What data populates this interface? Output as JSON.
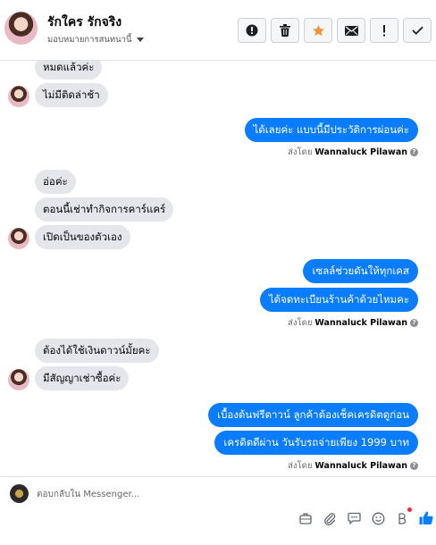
{
  "header": {
    "contact_name": "รักใคร รักจริง",
    "assignment_label": "มอบหมายการสนทนานี้",
    "actions": [
      {
        "name": "spam-button",
        "icon": "alert-circle-icon"
      },
      {
        "name": "delete-button",
        "icon": "trash-icon"
      },
      {
        "name": "star-button",
        "icon": "star-icon",
        "color": "#f7923a"
      },
      {
        "name": "unread-button",
        "icon": "envelope-icon"
      },
      {
        "name": "follow-up-button",
        "icon": "exclamation-icon"
      },
      {
        "name": "done-button",
        "icon": "checkmark-icon"
      }
    ]
  },
  "messages": {
    "m1": "หมดแล้วค่ะ",
    "m2": "ไม่มีติดล่าช้า",
    "m3": "ได้เลยค่ะ แบบนี้มีประวัติการผ่อนค่ะ",
    "m4": "อ่อค่ะ",
    "m5": "ตอนนี้เช่าทำกิจการคาร์แคร์",
    "m6": "เปิดเป็นของตัวเอง",
    "m7": "เซลล์ช่วยดันให้ทุกเคส",
    "m8": "ได้จดทะเบียนร้านค้าด้วยไหมคะ",
    "m9": "ต้องได้ใช้เงินดาวน์มั้ยคะ",
    "m10": "มีสัญญาเช่าซื้อค่ะ",
    "m11": "เบื้องต้นฟรีดาวน์  ลูกค้าต้องเช็คเครดิตดูก่อน",
    "m12": "เครดิตดีผ่าน วันรับรถจ่ายเพียง 1999  บาท"
  },
  "sent_by": {
    "prefix": "ส่งโดย",
    "sender": "Wannaluck Pilawan"
  },
  "composer": {
    "placeholder": "ตอบกลับใน Messenger...",
    "tools": [
      "briefcase-icon",
      "paperclip-icon",
      "chat-bubble-icon",
      "emoji-icon",
      "b-letter-icon",
      "thumbs-up-icon"
    ]
  },
  "colors": {
    "outgoing_bubble": "#0a7cff",
    "incoming_bubble": "#e4e6eb",
    "star": "#f7923a",
    "like": "#0a7cff"
  }
}
